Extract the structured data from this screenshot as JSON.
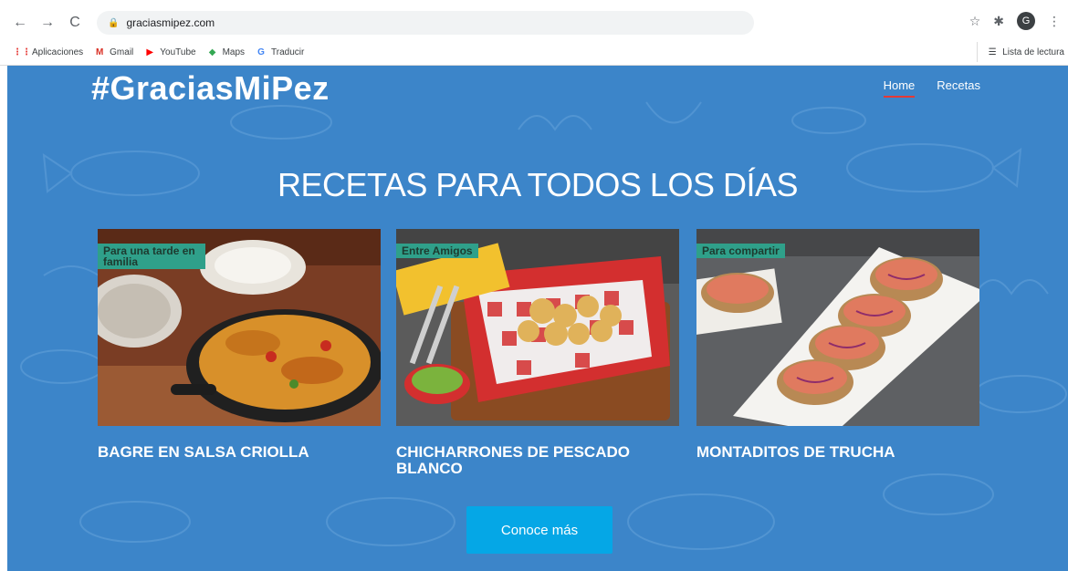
{
  "browser": {
    "back_icon": "←",
    "forward_icon": "→",
    "reload_icon": "C",
    "url": "graciasmipez.com",
    "star_icon": "☆",
    "ext_icon": "✱",
    "avatar_letter": "G",
    "menu_icon": "⋮",
    "bookmarks": [
      {
        "label": "Aplicaciones",
        "icon": "⋮⋮",
        "color": "#e53935"
      },
      {
        "label": "Gmail",
        "icon": "M",
        "color": "#d93025"
      },
      {
        "label": "YouTube",
        "icon": "▶",
        "color": "#ff0000"
      },
      {
        "label": "Maps",
        "icon": "◆",
        "color": "#34a853"
      },
      {
        "label": "Traducir",
        "icon": "G",
        "color": "#4285f4"
      }
    ],
    "reading_list": "Lista de lectura",
    "reading_icon": "☰"
  },
  "site": {
    "brand": "#GraciasMiPez",
    "nav": [
      {
        "label": "Home",
        "active": true
      },
      {
        "label": "Recetas",
        "active": false
      }
    ],
    "headline": "RECETAS PARA TODOS LOS DÍAS",
    "cards": [
      {
        "tag": "Para una tarde en familia",
        "title": "BAGRE EN SALSA CRIOLLA"
      },
      {
        "tag": "Entre Amigos",
        "title": "CHICHARRONES DE PESCADO BLANCO"
      },
      {
        "tag": "Para compartir",
        "title": "MONTADITOS DE TRUCHA"
      }
    ],
    "cta": "Conoce más"
  },
  "colors": {
    "background": "#3c85c9",
    "cta": "#05a7e6",
    "tag": "#2fa08a",
    "active_underline": "#e53935"
  }
}
